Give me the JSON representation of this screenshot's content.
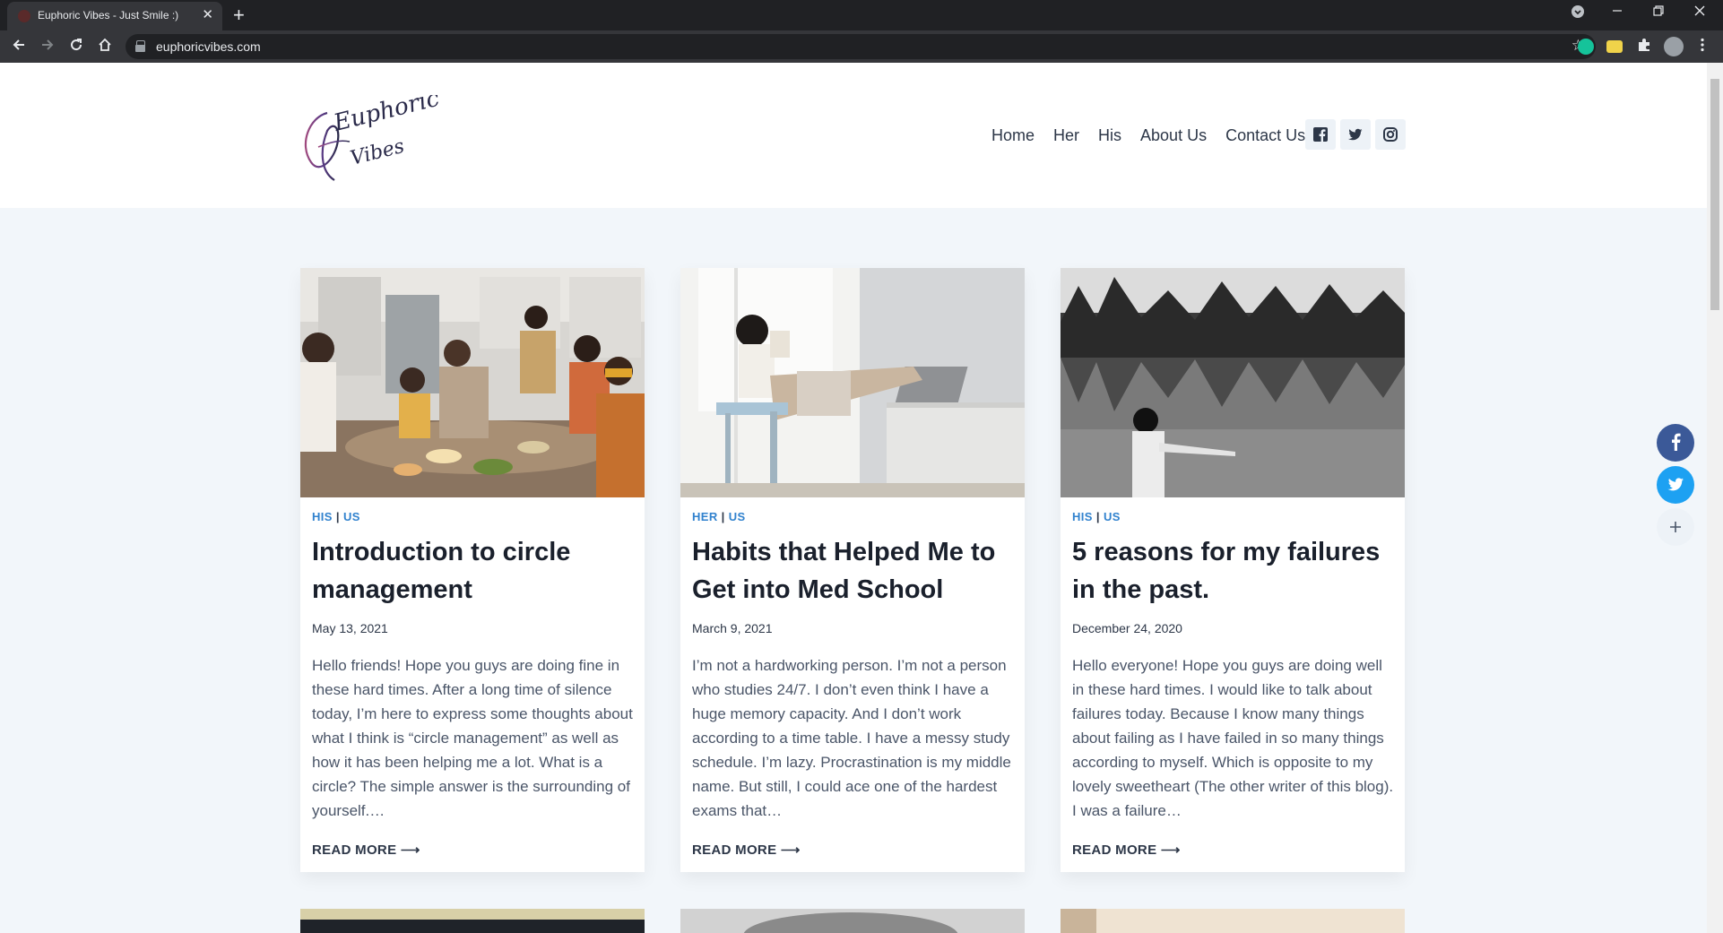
{
  "browser": {
    "tab_title": "Euphoric Vibes - Just Smile :)",
    "tab_close": "✕",
    "new_tab": "+",
    "url": "euphoricvibes.com"
  },
  "site": {
    "logo_text_1": "Euphoric",
    "logo_text_2": "Vibes",
    "nav": [
      "Home",
      "Her",
      "His",
      "About Us",
      "Contact Us"
    ],
    "social": [
      "facebook-icon",
      "twitter-icon",
      "instagram-icon"
    ]
  },
  "posts": [
    {
      "cat1": "HIS",
      "cat2": "US",
      "title": "Introduction to circle management",
      "date": "May 13, 2021",
      "excerpt": "Hello friends! Hope you guys are doing fine in these hard times. After a long time of silence today, I’m here to express some thoughts about what I think is “circle management” as well as how it has been helping me a lot. What is a circle? The simple answer is the surrounding of yourself.…",
      "read_more": "READ MORE ⟶"
    },
    {
      "cat1": "HER",
      "cat2": "US",
      "title": "Habits that Helped Me to Get into Med School",
      "date": "March 9, 2021",
      "excerpt": "I’m not a hardworking person. I’m not a person who studies 24/7. I don’t even think I have a huge memory capacity. And I don’t work according to a time table. I have a messy study schedule. I’m lazy. Procrastination is my middle name. But still, I could ace one of the hardest exams that…",
      "read_more": "READ MORE ⟶"
    },
    {
      "cat1": "HIS",
      "cat2": "US",
      "title": "5 reasons for my failures in the past.",
      "date": "December 24, 2020",
      "excerpt": "Hello everyone! Hope you guys are doing well in these hard times. I would like to talk about failures today. Because I know many things about failing as I have failed in so many things according to myself. Which is opposite to my lovely sweetheart (The other writer of this blog).  I was a failure…",
      "read_more": "READ MORE ⟶"
    }
  ],
  "colors": {
    "accent": "#3182ce",
    "facebook": "#3b5998",
    "twitter": "#1da1f2"
  }
}
